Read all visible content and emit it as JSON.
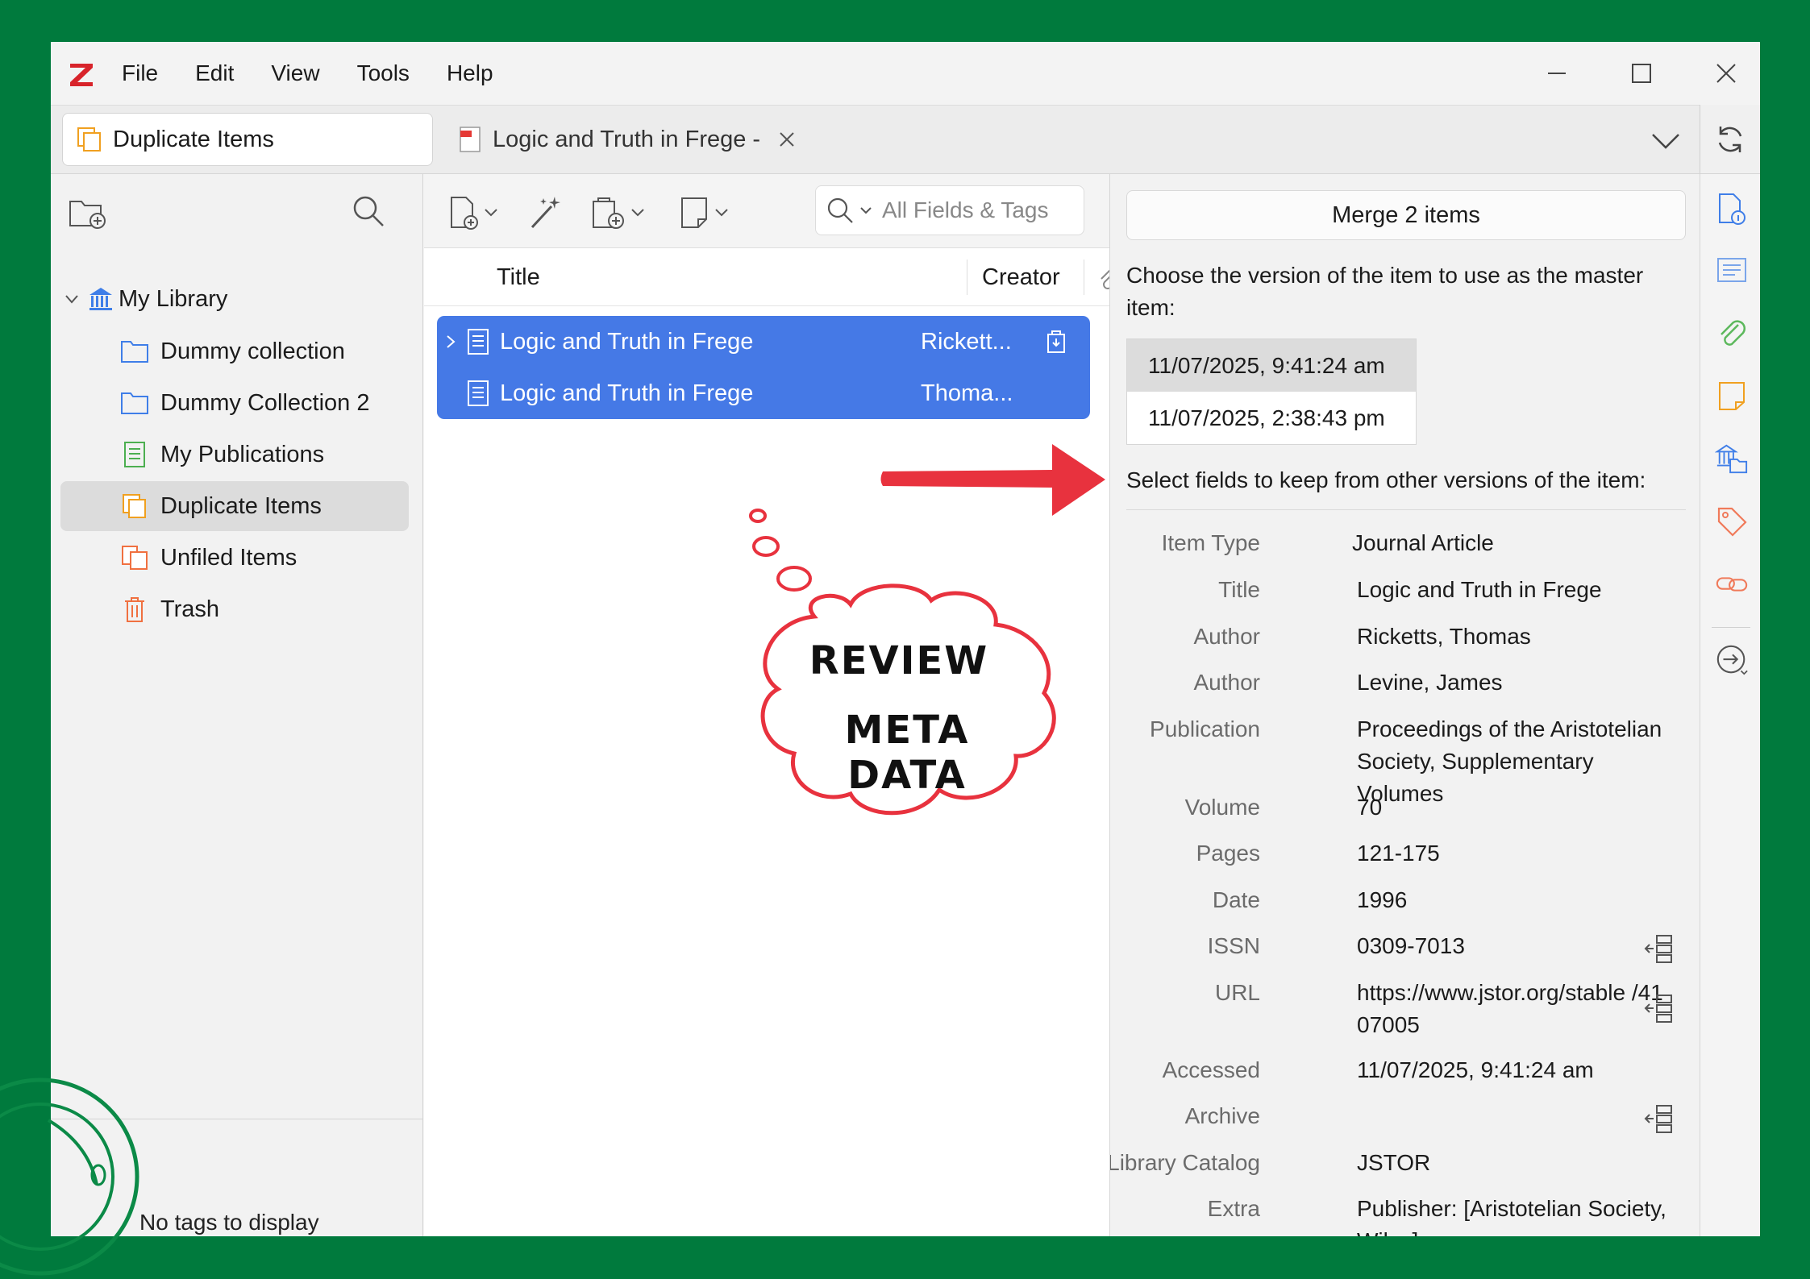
{
  "menubar": {
    "logo": "Z",
    "items": [
      "File",
      "Edit",
      "View",
      "Tools",
      "Help"
    ]
  },
  "tabs": {
    "active": "Duplicate Items",
    "inactive": "Logic and Truth in Frege -"
  },
  "library": {
    "root": "My Library",
    "items": [
      {
        "label": "Dummy collection",
        "icon": "folder-icon"
      },
      {
        "label": "Dummy Collection 2",
        "icon": "folder-icon"
      },
      {
        "label": "My Publications",
        "icon": "publications-icon"
      },
      {
        "label": "Duplicate Items",
        "icon": "duplicate-icon"
      },
      {
        "label": "Unfiled Items",
        "icon": "unfiled-icon"
      },
      {
        "label": "Trash",
        "icon": "trash-icon"
      }
    ],
    "tags_empty": "No tags to display"
  },
  "items_pane": {
    "search_placeholder": "All Fields & Tags",
    "col_title": "Title",
    "col_creator": "Creator",
    "rows": [
      {
        "title": "Logic and Truth in Frege",
        "creator": "Rickett..."
      },
      {
        "title": "Logic and Truth in Frege",
        "creator": "Thoma..."
      }
    ]
  },
  "merge_pane": {
    "merge_button": "Merge 2 items",
    "choose_text": "Choose the version of the item to use as the master item:",
    "versions": [
      "11/07/2025, 9:41:24 am",
      "11/07/2025, 2:38:43 pm"
    ],
    "select_text": "Select fields to keep from other versions of the item:",
    "fields": [
      {
        "label": "Item Type",
        "value": "Journal Article"
      },
      {
        "label": "Title",
        "value": "Logic and Truth in Frege"
      },
      {
        "label": "Author",
        "value": "Ricketts, Thomas"
      },
      {
        "label": "Author",
        "value": "Levine, James"
      },
      {
        "label": "Publication",
        "value": "Proceedings of the Aristotelian Society, Supplementary Volumes"
      },
      {
        "label": "Volume",
        "value": "70"
      },
      {
        "label": "Pages",
        "value": "121-175"
      },
      {
        "label": "Date",
        "value": "1996"
      },
      {
        "label": "ISSN",
        "value": "0309-7013"
      },
      {
        "label": "URL",
        "value": "https://www.jstor.org/stable /4107005"
      },
      {
        "label": "Accessed",
        "value": "11/07/2025, 9:41:24 am"
      },
      {
        "label": "Archive",
        "value": ""
      },
      {
        "label": "Library Catalog",
        "value": "JSTOR"
      },
      {
        "label": "Extra",
        "value": "Publisher: [Aristotelian Society, Wiley]"
      }
    ]
  },
  "annotation": {
    "line1": "REVIEW",
    "line2": "META DATA"
  },
  "colors": {
    "background": "#007a3d",
    "selection": "#4579e6",
    "accent_red": "#e8323e",
    "logo_red": "#d8232a"
  }
}
